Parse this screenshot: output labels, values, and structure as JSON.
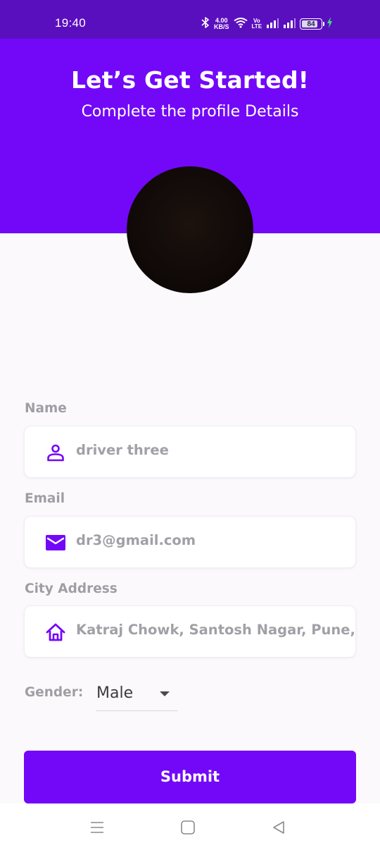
{
  "status_bar": {
    "time": "19:40",
    "network_speed_value": "4.00",
    "network_speed_unit": "KB/S",
    "volte_top": "Vo",
    "volte_bottom": "LTE",
    "battery_level": "84",
    "battery_fraction": 0.84
  },
  "header": {
    "title": "Let’s Get Started!",
    "subtitle": "Complete the profile Details",
    "color": "#7308f8"
  },
  "form": {
    "name": {
      "label": "Name",
      "value": "driver three",
      "icon": "person-icon"
    },
    "email": {
      "label": "Email",
      "value": "dr3@gmail.com",
      "icon": "mail-icon"
    },
    "city": {
      "label": "City Address",
      "value": "Katraj Chowk, Santosh Nagar, Pune, Maharashtra",
      "icon": "home-icon"
    },
    "gender": {
      "label": "Gender:",
      "value": "Male"
    }
  },
  "submit": {
    "label": "Submit",
    "color": "#7308f8"
  },
  "nav": {
    "icons": [
      "menu-icon",
      "home-square-icon",
      "back-triangle-icon"
    ]
  }
}
